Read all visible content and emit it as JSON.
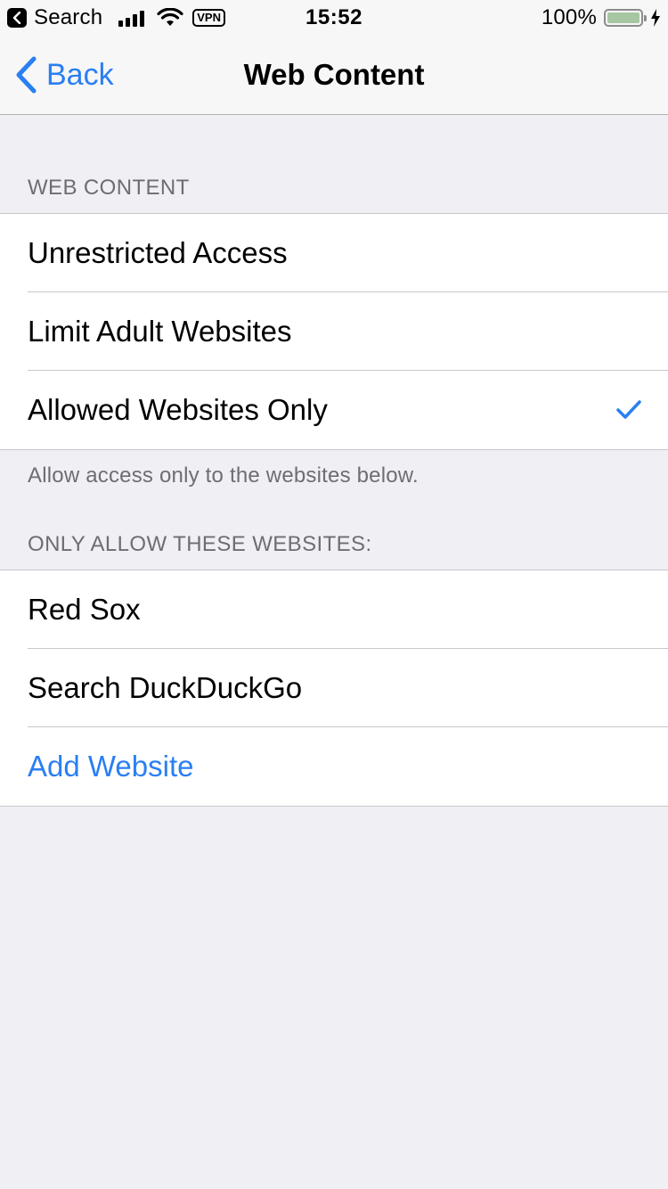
{
  "status_bar": {
    "back_app": "Search",
    "vpn": "VPN",
    "time": "15:52",
    "battery_percent": "100%",
    "battery_level": 1.0
  },
  "nav": {
    "back_label": "Back",
    "title": "Web Content"
  },
  "web_content": {
    "header": "WEB CONTENT",
    "options": [
      {
        "label": "Unrestricted Access",
        "selected": false
      },
      {
        "label": "Limit Adult Websites",
        "selected": false
      },
      {
        "label": "Allowed Websites Only",
        "selected": true
      }
    ],
    "footer": "Allow access only to the websites below."
  },
  "allowed_sites": {
    "header": "ONLY ALLOW THESE WEBSITES:",
    "sites": [
      "Red Sox",
      "Search DuckDuckGo"
    ],
    "add_label": "Add Website"
  },
  "colors": {
    "accent": "#2a7ff2",
    "background": "#efeff4",
    "secondary_text": "#6d6d72"
  }
}
